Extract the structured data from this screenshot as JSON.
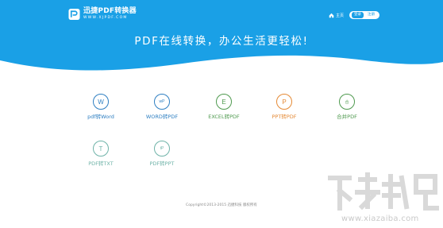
{
  "header": {
    "logo_name": "迅捷PDF转换器",
    "logo_url": "WWW.XJPDF.COM",
    "home_label": "主页",
    "login_label": "登录",
    "register_label": "注册",
    "slogan": "PDF在线转换，办公生活更轻松!"
  },
  "tools": [
    {
      "icon_char": "W",
      "label": "pdf转Word",
      "color": "#2e7fc2"
    },
    {
      "icon_char": "wP",
      "label": "WORD转PDF",
      "color": "#2e7fc2"
    },
    {
      "icon_char": "E",
      "label": "EXCEL转PDF",
      "color": "#4f9a4f"
    },
    {
      "icon_char": "P",
      "label": "PPT转PDF",
      "color": "#e58a35"
    },
    {
      "icon_char": "合",
      "label": "合并PDF",
      "color": "#4f9a4f"
    },
    {
      "icon_char": "T",
      "label": "PDF转TXT",
      "color": "#6fb3a8"
    },
    {
      "icon_char": "tP",
      "label": "PDF转PPT",
      "color": "#6fb3a8"
    }
  ],
  "footer": {
    "copyright": "Copyright©2013-2015 迅捷科技 版权所有"
  },
  "watermark": {
    "url": "www.xiazaiba.com"
  },
  "colors": {
    "brand": "#1aa0e6"
  }
}
